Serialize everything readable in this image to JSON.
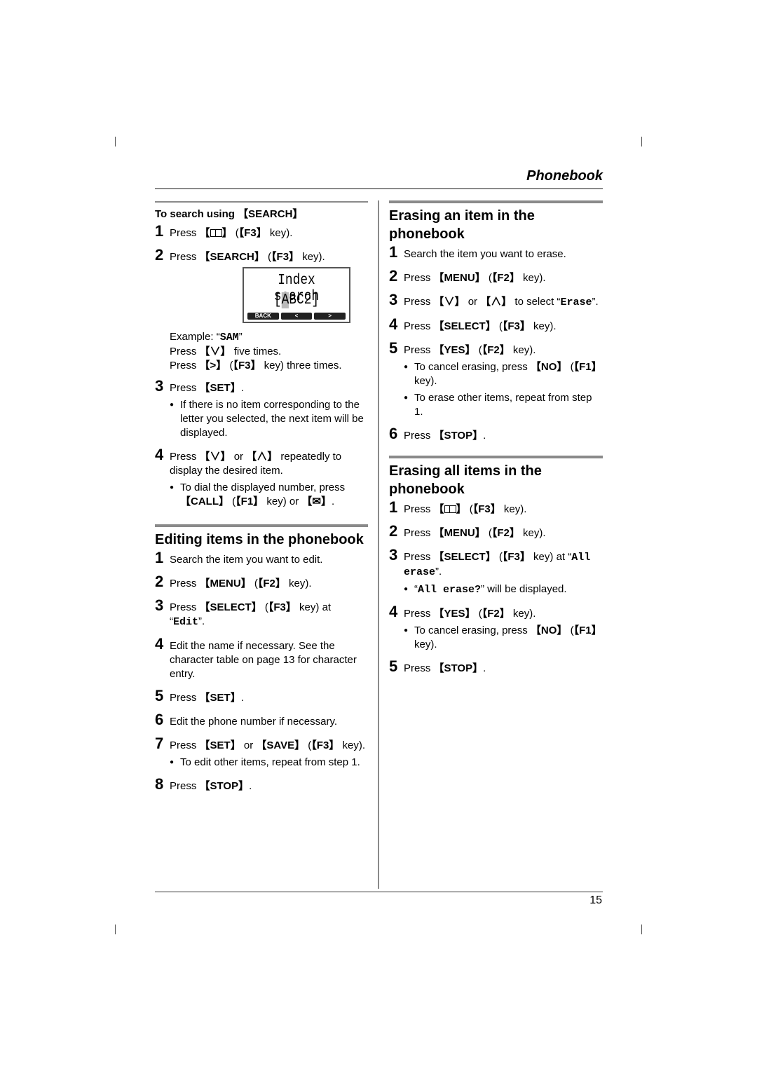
{
  "header": {
    "title": "Phonebook"
  },
  "footer": {
    "page_number": "15"
  },
  "search_section": {
    "subheading": "To search using 【SEARCH】",
    "steps": [
      {
        "num": "1",
        "pre": "Press ",
        "key": "【",
        "icon": "phonebook-icon",
        "post_key": "】",
        "rest_pre": " (",
        "key2": "【F3】",
        "rest": " key)."
      },
      {
        "num": "2",
        "pre": "Press ",
        "key": "【SEARCH】",
        "rest_pre": " (",
        "key2": "【F3】",
        "rest": " key)."
      }
    ],
    "lcd": {
      "line1": "Index search",
      "line2_open": "[",
      "line2_cursor": "A",
      "line2_rest": "BC2]",
      "softkeys": [
        "BACK",
        "<",
        ">"
      ]
    },
    "example": {
      "label": "Example: “",
      "value": "SAM",
      "close": "”",
      "line2_pre": "Press ",
      "line2_key": "【∨】",
      "line2_rest": " five times.",
      "line3_pre": "Press ",
      "line3_key": "【>】",
      "line3_mid": " (",
      "line3_key2": "【F3】",
      "line3_rest": " key) three times."
    },
    "step3": {
      "num": "3",
      "pre": "Press ",
      "key": "【SET】",
      "rest": ".",
      "bullet": "If there is no item corresponding to the letter you selected, the next item will be displayed."
    },
    "step4": {
      "num": "4",
      "pre": "Press ",
      "key": "【∨】",
      "mid": " or ",
      "key2": "【∧】",
      "rest": " repeatedly to display the desired item.",
      "bullet_pre": "To dial the displayed number, press ",
      "bullet_key": "【CALL】",
      "bullet_mid": " (",
      "bullet_key2": "【F1】",
      "bullet_mid2": " key) or ",
      "bullet_key3": "【✉】",
      "bullet_end": "."
    }
  },
  "edit_section": {
    "title": "Editing items in the phonebook",
    "steps": [
      {
        "num": "1",
        "text": "Search the item you want to edit."
      },
      {
        "num": "2",
        "pre": "Press ",
        "key": "【MENU】",
        "mid": " (",
        "key2": "【F2】",
        "rest": " key)."
      },
      {
        "num": "3",
        "pre": "Press ",
        "key": "【SELECT】",
        "mid": " (",
        "key2": "【F3】",
        "rest": " key) at “",
        "mono": "Edit",
        "end": "”."
      },
      {
        "num": "4",
        "text": "Edit the name if necessary. See the character table on page 13 for character entry."
      },
      {
        "num": "5",
        "pre": "Press ",
        "key": "【SET】",
        "rest": "."
      },
      {
        "num": "6",
        "text": "Edit the phone number if necessary."
      },
      {
        "num": "7",
        "pre": "Press ",
        "key": "【SET】",
        "mid": " or ",
        "key2": "【SAVE】",
        "mid2": " (",
        "key3": "【F3】",
        "rest": " key).",
        "bullet": "To edit other items, repeat from step 1."
      },
      {
        "num": "8",
        "pre": "Press ",
        "key": "【STOP】",
        "rest": "."
      }
    ]
  },
  "erase_item_section": {
    "title": "Erasing an item in the phonebook",
    "steps": [
      {
        "num": "1",
        "text": "Search the item you want to erase."
      },
      {
        "num": "2",
        "pre": "Press ",
        "key": "【MENU】",
        "mid": " (",
        "key2": "【F2】",
        "rest": " key)."
      },
      {
        "num": "3",
        "pre": "Press ",
        "key": "【∨】",
        "mid": " or ",
        "key2": "【∧】",
        "rest": " to select “",
        "mono": "Erase",
        "end": "”."
      },
      {
        "num": "4",
        "pre": "Press ",
        "key": "【SELECT】",
        "mid": " (",
        "key2": "【F3】",
        "rest": " key)."
      },
      {
        "num": "5",
        "pre": "Press ",
        "key": "【YES】",
        "mid": " (",
        "key2": "【F2】",
        "rest": " key).",
        "bullet1_pre": "To cancel erasing, press ",
        "bullet1_key": "【NO】",
        "bullet1_mid": " (",
        "bullet1_key2": "【F1】",
        "bullet1_end": " key).",
        "bullet2": "To erase other items, repeat from step 1."
      },
      {
        "num": "6",
        "pre": "Press ",
        "key": "【STOP】",
        "rest": "."
      }
    ]
  },
  "erase_all_section": {
    "title": "Erasing all items in the phonebook",
    "steps": [
      {
        "num": "1",
        "pre": "Press ",
        "key_open": "【",
        "key_close": "】",
        "mid": " (",
        "key2": "【F3】",
        "rest": " key)."
      },
      {
        "num": "2",
        "pre": "Press ",
        "key": "【MENU】",
        "mid": " (",
        "key2": "【F2】",
        "rest": " key)."
      },
      {
        "num": "3",
        "pre": "Press ",
        "key": "【SELECT】",
        "mid": " (",
        "key2": "【F3】",
        "rest": " key) at “",
        "mono": "All erase",
        "end": "”.",
        "bullet_open": "“",
        "bullet_mono": "All erase?",
        "bullet_rest": "” will be displayed."
      },
      {
        "num": "4",
        "pre": "Press ",
        "key": "【YES】",
        "mid": " (",
        "key2": "【F2】",
        "rest": " key).",
        "bullet_pre": "To cancel erasing, press ",
        "bullet_key": "【NO】",
        "bullet_mid": " (",
        "bullet_key2": "【F1】",
        "bullet_end": " key)."
      },
      {
        "num": "5",
        "pre": "Press ",
        "key": "【STOP】",
        "rest": "."
      }
    ]
  }
}
